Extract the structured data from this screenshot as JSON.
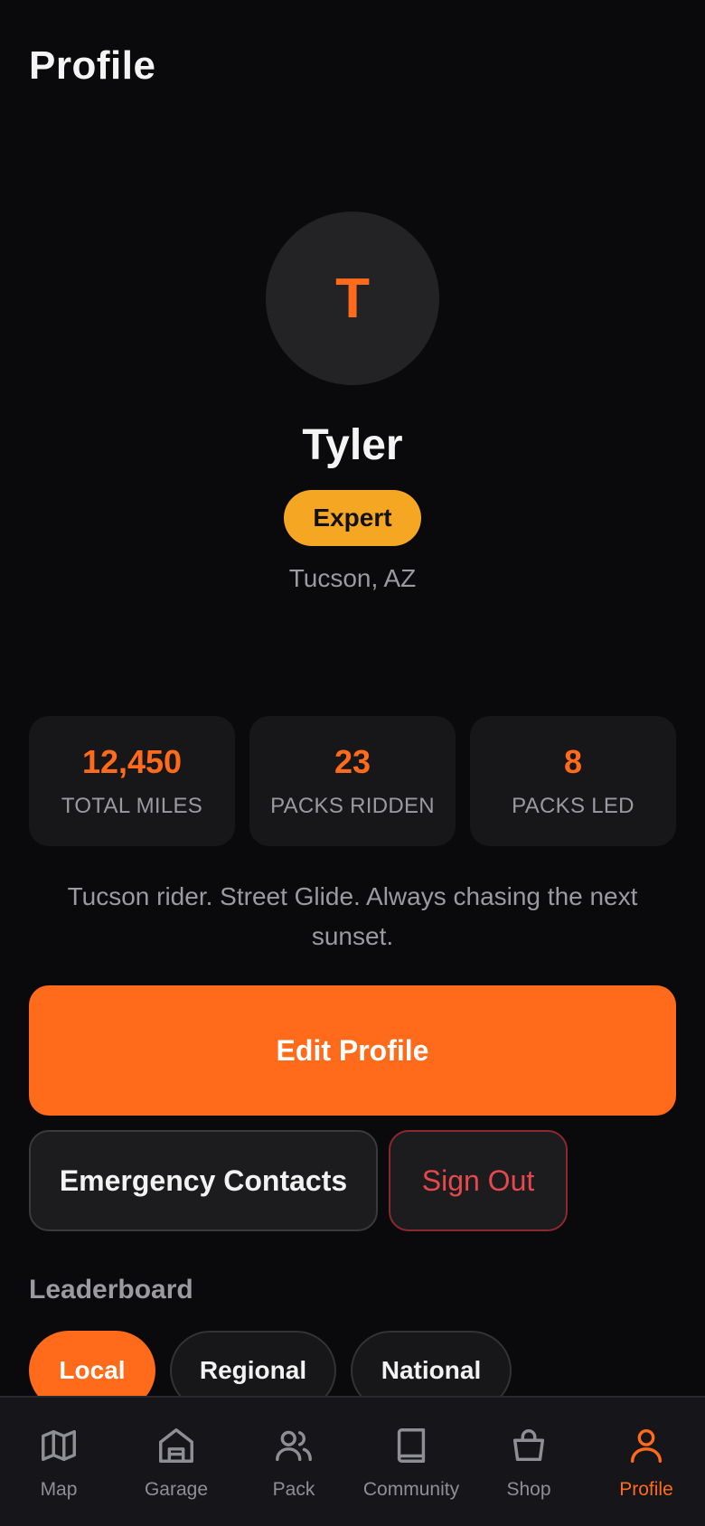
{
  "header": {
    "title": "Profile"
  },
  "profile": {
    "avatar_initial": "T",
    "name": "Tyler",
    "level_badge": "Expert",
    "location": "Tucson, AZ",
    "bio": "Tucson rider. Street Glide. Always chasing the next sunset."
  },
  "stats": [
    {
      "value": "12,450",
      "label": "TOTAL MILES"
    },
    {
      "value": "23",
      "label": "PACKS RIDDEN"
    },
    {
      "value": "8",
      "label": "PACKS LED"
    }
  ],
  "actions": {
    "edit_profile": "Edit Profile",
    "emergency_contacts": "Emergency Contacts",
    "sign_out": "Sign Out"
  },
  "leaderboard": {
    "title": "Leaderboard",
    "scopes": [
      "Local",
      "Regional",
      "National"
    ],
    "selected": "Local"
  },
  "tabbar": {
    "items": [
      {
        "label": "Map",
        "icon": "map-icon"
      },
      {
        "label": "Garage",
        "icon": "garage-icon"
      },
      {
        "label": "Pack",
        "icon": "users-icon"
      },
      {
        "label": "Community",
        "icon": "book-icon"
      },
      {
        "label": "Shop",
        "icon": "shopping-bag-icon"
      },
      {
        "label": "Profile",
        "icon": "user-icon"
      }
    ],
    "active": "Profile"
  },
  "colors": {
    "accent": "#ff6b1a",
    "badge": "#f5a623",
    "danger": "#e5484d",
    "background": "#0a0a0c"
  }
}
